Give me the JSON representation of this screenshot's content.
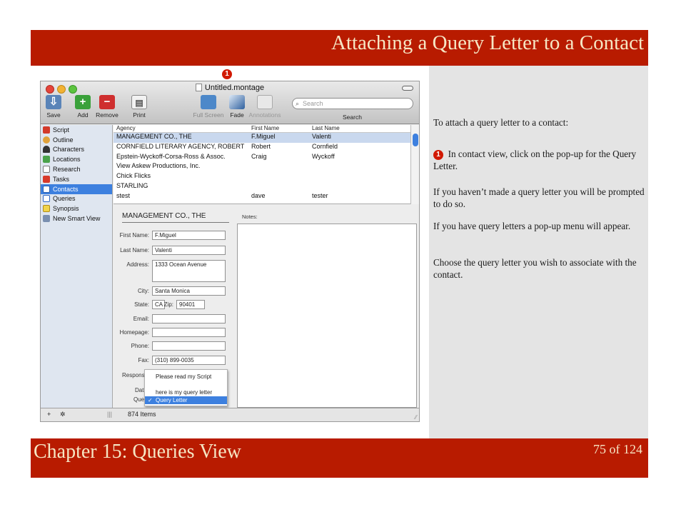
{
  "slide": {
    "title": "Attaching a Query Letter to a Contact",
    "chapter": "Chapter 15: Queries View",
    "page": "75 of 124",
    "callout_number": "1",
    "colors": {
      "bar": "#b81b00",
      "bar_text": "#f6e6c4",
      "panel": "#e4e4e4",
      "bullet": "#d11900"
    }
  },
  "instructions": {
    "intro": "To attach a query letter to a contact:",
    "step1": "In contact view, click on the pop-up for the Query Letter.",
    "p2": "If you haven’t made a query letter you will be prompted to do so.",
    "p3": "If you have query letters a pop-up menu will appear.",
    "p4": "Choose the query letter you wish to associate with the contact."
  },
  "window": {
    "title": "Untitled.montage",
    "toolbar": {
      "save": "Save",
      "add": "Add",
      "remove": "Remove",
      "print": "Print",
      "full_screen": "Full Screen",
      "fade": "Fade",
      "annotations": "Annotations",
      "search_label": "Search",
      "search_placeholder": "Search"
    },
    "sidebar": [
      {
        "label": "Script",
        "icon": "script-icon"
      },
      {
        "label": "Outline",
        "icon": "outline-icon"
      },
      {
        "label": "Characters",
        "icon": "characters-icon"
      },
      {
        "label": "Locations",
        "icon": "locations-icon"
      },
      {
        "label": "Research",
        "icon": "research-icon"
      },
      {
        "label": "Tasks",
        "icon": "tasks-icon"
      },
      {
        "label": "Contacts",
        "icon": "contacts-icon",
        "selected": true
      },
      {
        "label": "Queries",
        "icon": "queries-icon"
      },
      {
        "label": "Synopsis",
        "icon": "synopsis-icon"
      },
      {
        "label": "New Smart View",
        "icon": "smart-view-icon"
      }
    ],
    "list": {
      "headers": [
        "Agency",
        "First Name",
        "Last Name"
      ],
      "rows": [
        [
          "MANAGEMENT CO., THE",
          "F.Miguel",
          "Valenti"
        ],
        [
          "CORNFIELD LITERARY AGENCY, ROBERT",
          "Robert",
          "Cornfield"
        ],
        [
          "Epstein-Wyckoff-Corsa-Ross & Assoc.",
          "Craig",
          "Wyckoff"
        ],
        [
          "View Askew Productions, Inc.",
          "",
          ""
        ],
        [
          "Chick Flicks",
          "",
          ""
        ],
        [
          "STARLING",
          "",
          ""
        ],
        [
          "stest",
          "dave",
          "tester"
        ]
      ]
    },
    "detail": {
      "heading": "MANAGEMENT CO., THE",
      "notes_label": "Notes:",
      "first_name_label": "First Name:",
      "first_name": "F.Miguel",
      "last_name_label": "Last Name:",
      "last_name": "Valenti",
      "address_label": "Address:",
      "address": "1333 Ocean Avenue",
      "city_label": "City:",
      "city": "Santa Monica",
      "state_label": "State:",
      "state": "CA",
      "zip_label": "Zip:",
      "zip": "90401",
      "email_label": "Email:",
      "email": "",
      "homepage_label": "Homepage:",
      "homepage": "",
      "phone_label": "Phone:",
      "phone": "",
      "fax_label": "Fax:",
      "fax": "(310) 899-0035",
      "response_label": "Respons",
      "date_label": "Dat",
      "query_label": "Que"
    },
    "popup": {
      "items": [
        "Please read my Script",
        "here is my query letter",
        "Query Letter"
      ],
      "selected": "Query Letter"
    },
    "footer": {
      "count": "874 Items",
      "add": "+",
      "gear": "✲"
    }
  }
}
